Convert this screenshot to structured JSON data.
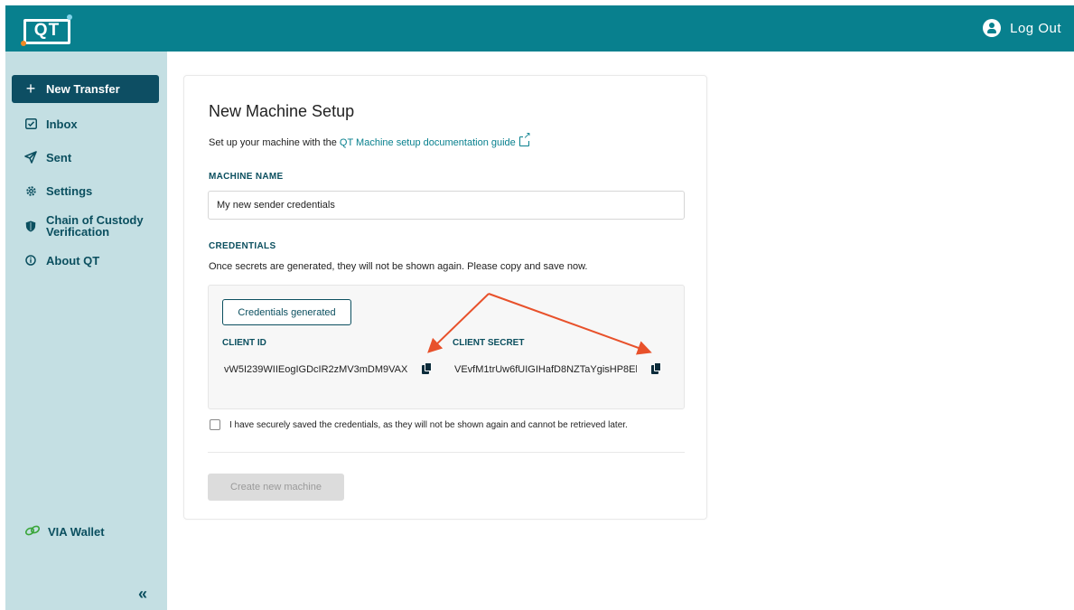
{
  "header": {
    "logo_text": "QT",
    "logout_label": "Log Out"
  },
  "sidebar": {
    "items": [
      {
        "label": "New Transfer",
        "icon": "plus-icon"
      },
      {
        "label": "Inbox",
        "icon": "inbox-icon"
      },
      {
        "label": "Sent",
        "icon": "send-icon"
      },
      {
        "label": "Settings",
        "icon": "gear-icon"
      },
      {
        "label_line1": "Chain of Custody",
        "label_line2": "Verification",
        "icon": "shield-icon"
      },
      {
        "label": "About QT",
        "icon": "info-icon"
      }
    ],
    "via_wallet": "VIA Wallet",
    "collapse_glyph": "«"
  },
  "main": {
    "title": "New Machine Setup",
    "subtitle_prefix": "Set up your machine with the ",
    "subtitle_link": "QT Machine setup documentation guide",
    "machine_name_label": "MACHINE NAME",
    "machine_name_value": "My new sender credentials",
    "credentials_label": "CREDENTIALS",
    "credentials_note": "Once secrets are generated, they will not be shown again. Please copy and save now.",
    "generated_button": "Credentials generated",
    "client_id_label": "CLIENT ID",
    "client_id_value": "vW5I239WIIEogIGDcIR2zMV3mDM9VAX",
    "client_secret_label": "CLIENT SECRET",
    "client_secret_value": "VEvfM1trUw6fUIGIHafD8NZTaYgisHP8El",
    "confirm_text": "I have securely saved the credentials, as they will not be shown again and cannot be retrieved later.",
    "create_button": "Create new machine"
  },
  "colors": {
    "brand_teal": "#08808e",
    "sidebar_bg": "#c4dfe3",
    "active_nav": "#0d4e63",
    "annotation_arrow": "#e8512b"
  }
}
